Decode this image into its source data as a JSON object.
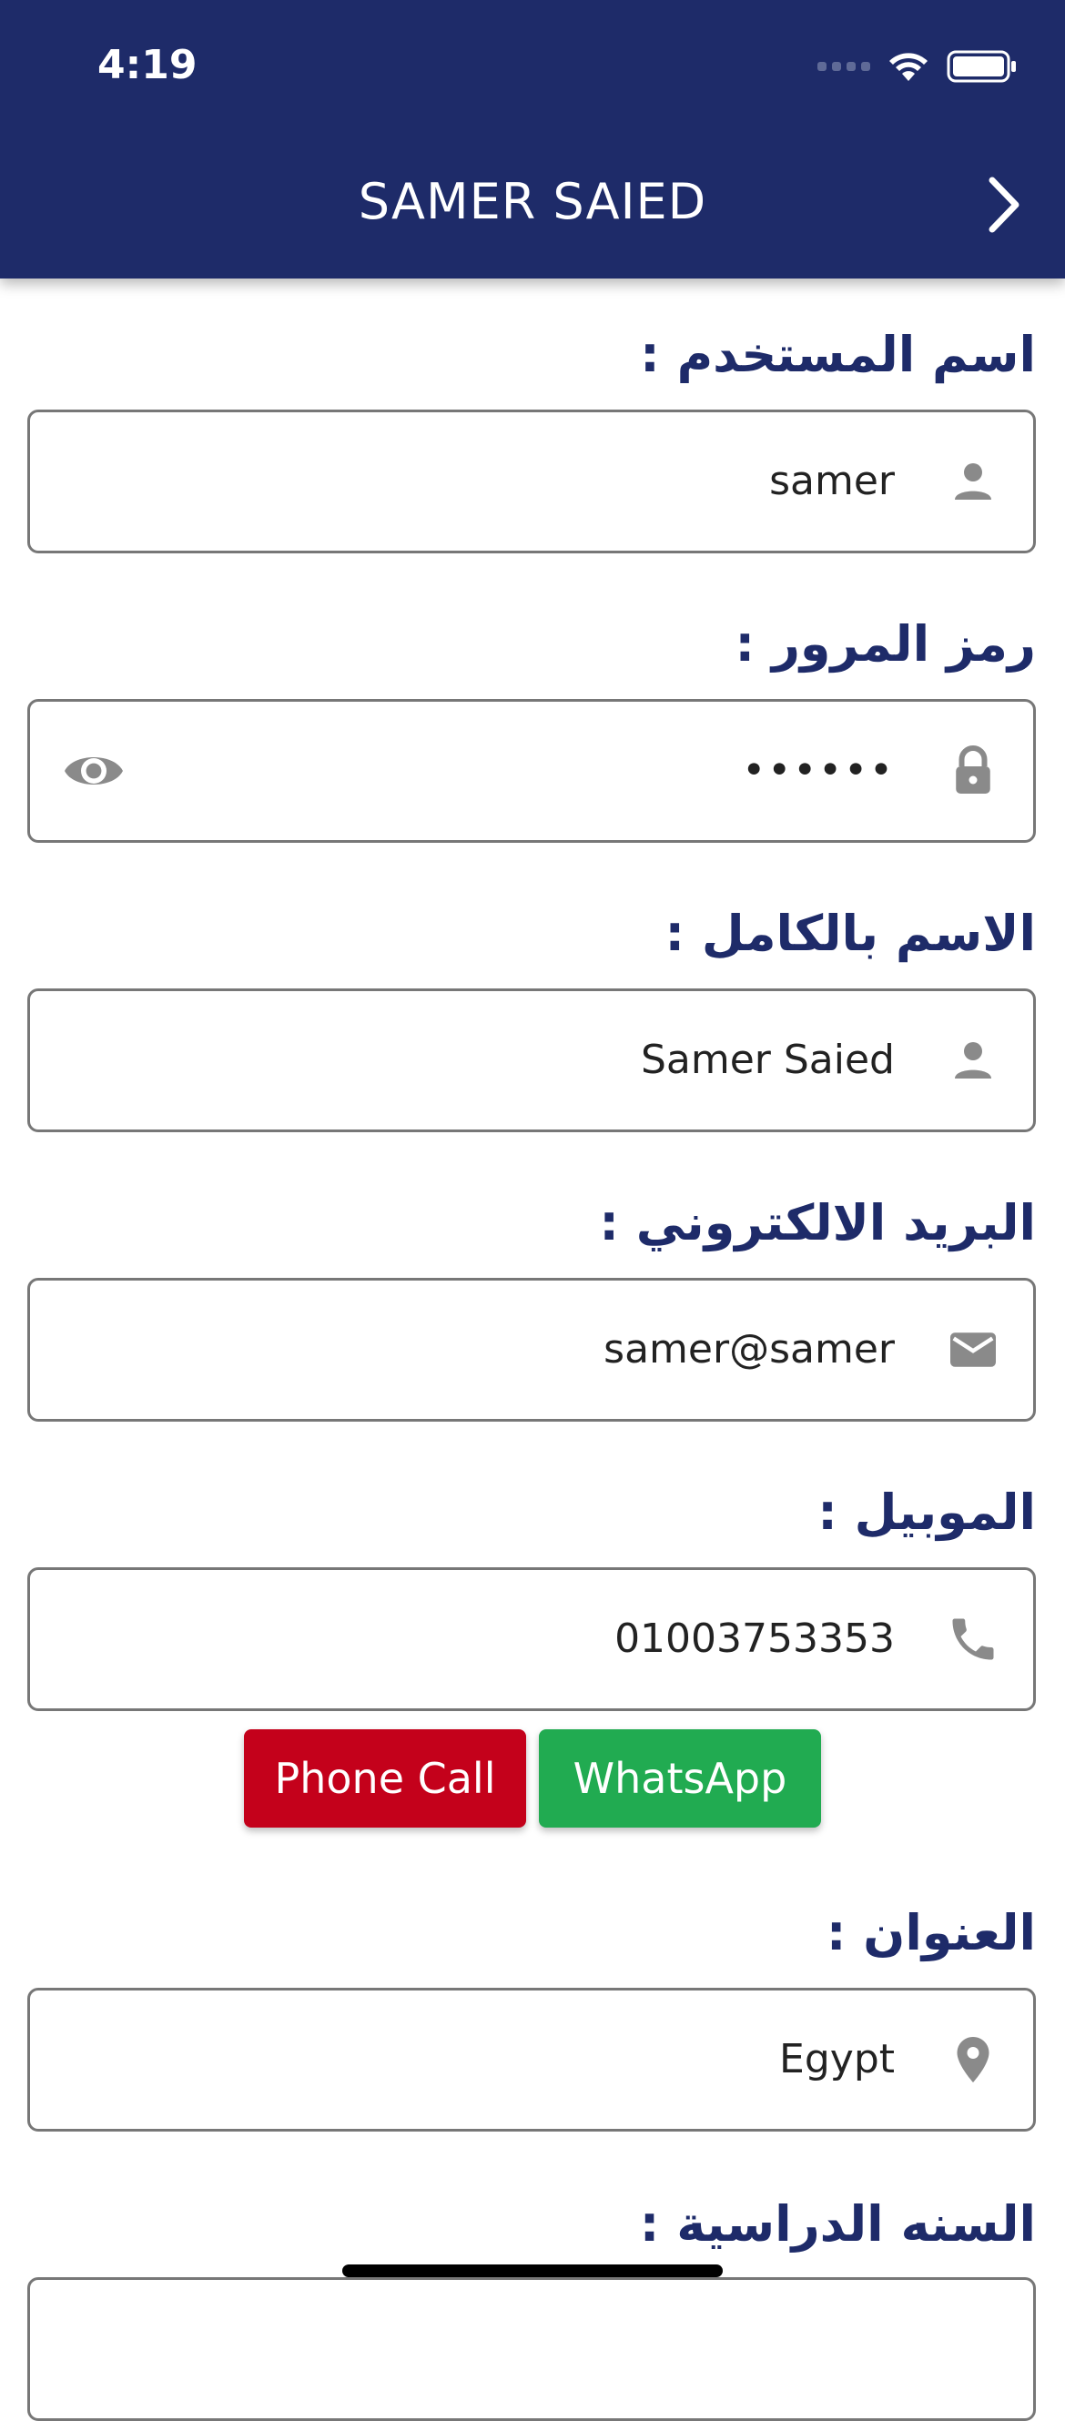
{
  "status_bar": {
    "time": "4:19"
  },
  "header": {
    "title": "SAMER SAIED",
    "back_icon": "chevron-right-icon"
  },
  "fields": {
    "username": {
      "label": "اسم المستخدم :",
      "value": "samer",
      "icon": "person-icon"
    },
    "password": {
      "label": "رمز المرور :",
      "value": "••••••",
      "icon": "lock-icon",
      "toggle_icon": "eye-icon"
    },
    "full_name": {
      "label": "الاسم بالكامل :",
      "value": "Samer Saied",
      "icon": "person-icon"
    },
    "email": {
      "label": "البريد الالكتروني :",
      "value": "samer@samer",
      "icon": "mail-icon"
    },
    "mobile": {
      "label": "الموبيل :",
      "value": "01003753353",
      "icon": "phone-icon"
    },
    "address": {
      "label": "العنوان :",
      "value": "Egypt",
      "icon": "location-pin-icon"
    },
    "academic_year": {
      "label": "السنه الدراسية :"
    }
  },
  "buttons": {
    "phone_call": "Phone Call",
    "whatsapp": "WhatsApp"
  },
  "colors": {
    "header_bg": "#1e2b69",
    "label": "#1e2b69",
    "phone_call_bg": "#c4011b",
    "whatsapp_bg": "#21ab51",
    "icon": "#8a8a8a"
  }
}
